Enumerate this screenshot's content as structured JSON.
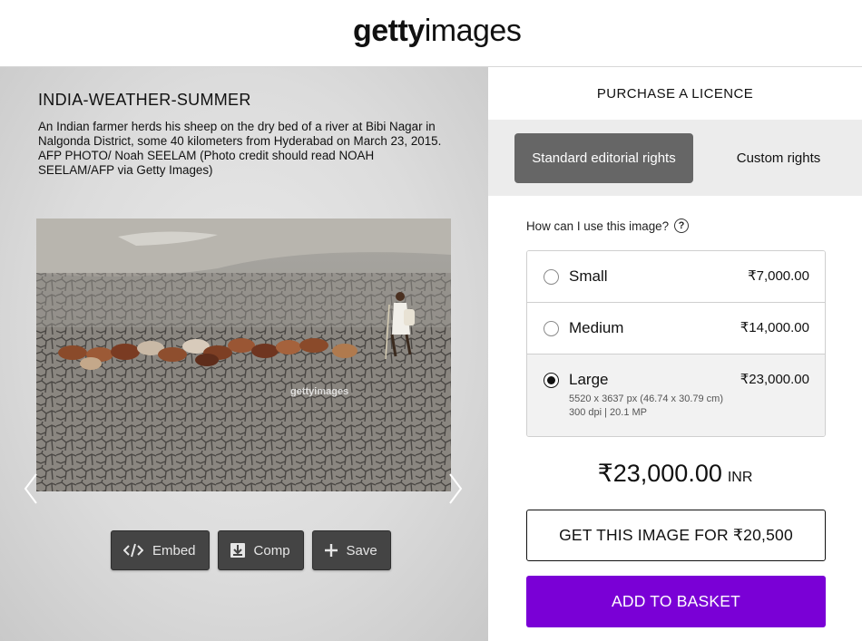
{
  "header": {
    "logo_bold": "getty",
    "logo_light": "images"
  },
  "image": {
    "title": "INDIA-WEATHER-SUMMER",
    "caption": "An Indian farmer herds his sheep on the dry bed of a river at Bibi Nagar in Nalgonda District, some 40 kilometers from Hyderabad on March 23, 2015. AFP PHOTO/ Noah SEELAM (Photo credit should read NOAH SEELAM/AFP via Getty Images)"
  },
  "tools": {
    "embed_label": "Embed",
    "comp_label": "Comp",
    "save_label": "Save"
  },
  "purchase": {
    "title": "PURCHASE A LICENCE",
    "tab_standard": "Standard editorial rights",
    "tab_custom": "Custom rights",
    "question": "How can I use this image?",
    "question_icon": "?",
    "options": [
      {
        "name": "Small",
        "price": "₹7,000.00",
        "selected": false
      },
      {
        "name": "Medium",
        "price": "₹14,000.00",
        "selected": false
      },
      {
        "name": "Large",
        "price": "₹23,000.00",
        "selected": true,
        "detail_line1": "5520 x 3637 px (46.74 x 30.79 cm)",
        "detail_line2": "300 dpi | 20.1 MP"
      }
    ],
    "total_amount": "₹23,000.00",
    "total_currency": "INR",
    "get_button": "GET THIS IMAGE FOR ₹20,500",
    "add_button": "ADD TO BASKET"
  },
  "colors": {
    "accent_purple": "#7a00d6",
    "active_tab": "#666666",
    "tool_button": "#444444"
  }
}
